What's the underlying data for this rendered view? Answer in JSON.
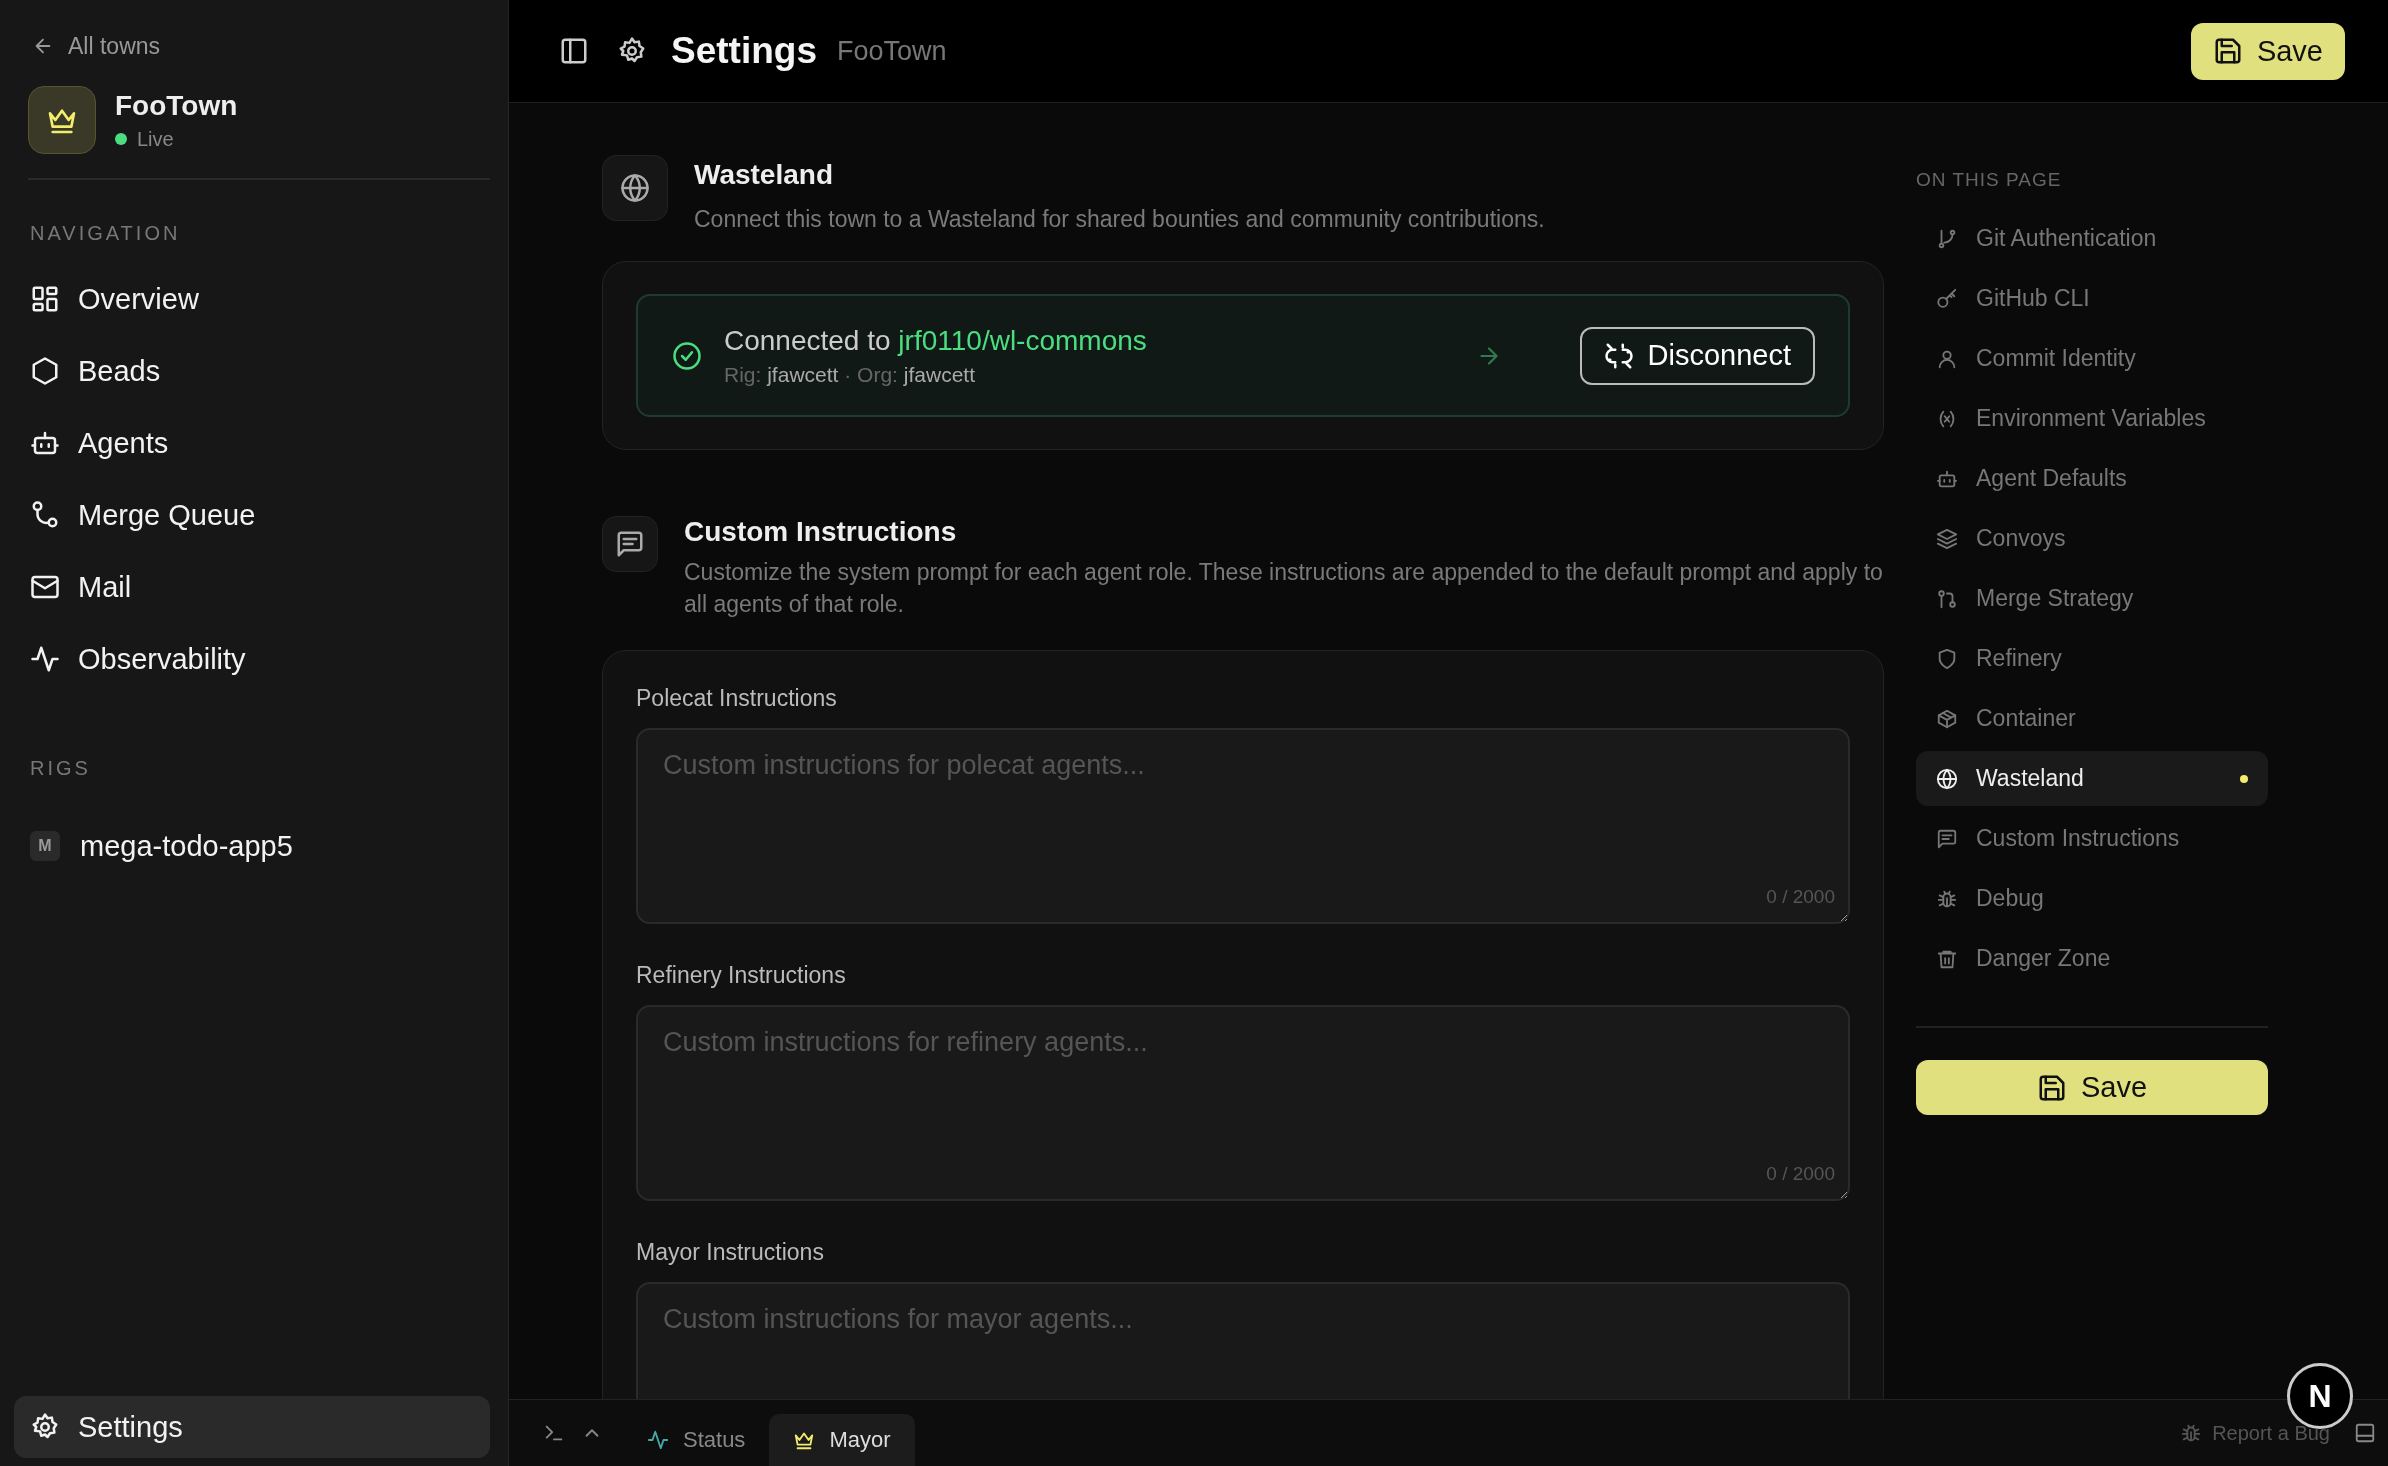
{
  "sidebar": {
    "back_link": "All towns",
    "town": {
      "name": "FooTown",
      "status": "Live"
    },
    "navigation_heading": "NAVIGATION",
    "nav_items": [
      {
        "label": "Overview",
        "selected": false
      },
      {
        "label": "Beads",
        "selected": false
      },
      {
        "label": "Agents",
        "selected": false
      },
      {
        "label": "Merge Queue",
        "selected": false
      },
      {
        "label": "Mail",
        "selected": false
      },
      {
        "label": "Observability",
        "selected": false
      }
    ],
    "rigs_heading": "RIGS",
    "rigs": [
      {
        "initial": "M",
        "name": "mega-todo-app5"
      }
    ],
    "settings_item": {
      "label": "Settings",
      "selected": true
    }
  },
  "header": {
    "title": "Settings",
    "subtitle": "FooTown",
    "save_button": "Save"
  },
  "wasteland": {
    "title": "Wasteland",
    "description": "Connect this town to a Wasteland for shared bounties and community contributions.",
    "connection": {
      "prefix": "Connected to",
      "repo": "jrf0110/wl-commons",
      "rig_label": "Rig:",
      "rig": "jfawcett",
      "separator": "·",
      "org_label": "Org:",
      "org": "jfawcett",
      "button": "Disconnect"
    }
  },
  "custom_instructions": {
    "title": "Custom Instructions",
    "description": "Customize the system prompt for each agent role. These instructions are appended to the default prompt and apply to all agents of that role.",
    "fields": [
      {
        "label": "Polecat Instructions",
        "placeholder": "Custom instructions for polecat agents...",
        "counter": "0 / 2000"
      },
      {
        "label": "Refinery Instructions",
        "placeholder": "Custom instructions for refinery agents...",
        "counter": "0 / 2000"
      },
      {
        "label": "Mayor Instructions",
        "placeholder": "Custom instructions for mayor agents..."
      }
    ]
  },
  "toc": {
    "heading": "ON THIS PAGE",
    "items": [
      {
        "label": "Git Authentication",
        "selected": false
      },
      {
        "label": "GitHub CLI",
        "selected": false
      },
      {
        "label": "Commit Identity",
        "selected": false
      },
      {
        "label": "Environment Variables",
        "selected": false
      },
      {
        "label": "Agent Defaults",
        "selected": false
      },
      {
        "label": "Convoys",
        "selected": false
      },
      {
        "label": "Merge Strategy",
        "selected": false
      },
      {
        "label": "Refinery",
        "selected": false
      },
      {
        "label": "Container",
        "selected": false
      },
      {
        "label": "Wasteland",
        "selected": true
      },
      {
        "label": "Custom Instructions",
        "selected": false
      },
      {
        "label": "Debug",
        "selected": false
      },
      {
        "label": "Danger Zone",
        "selected": false
      }
    ],
    "save_button": "Save"
  },
  "bottom_bar": {
    "tabs": [
      {
        "label": "Status",
        "selected": false
      },
      {
        "label": "Mayor",
        "selected": true
      }
    ],
    "report_link": "Report a Bug",
    "avatar": "N"
  }
}
